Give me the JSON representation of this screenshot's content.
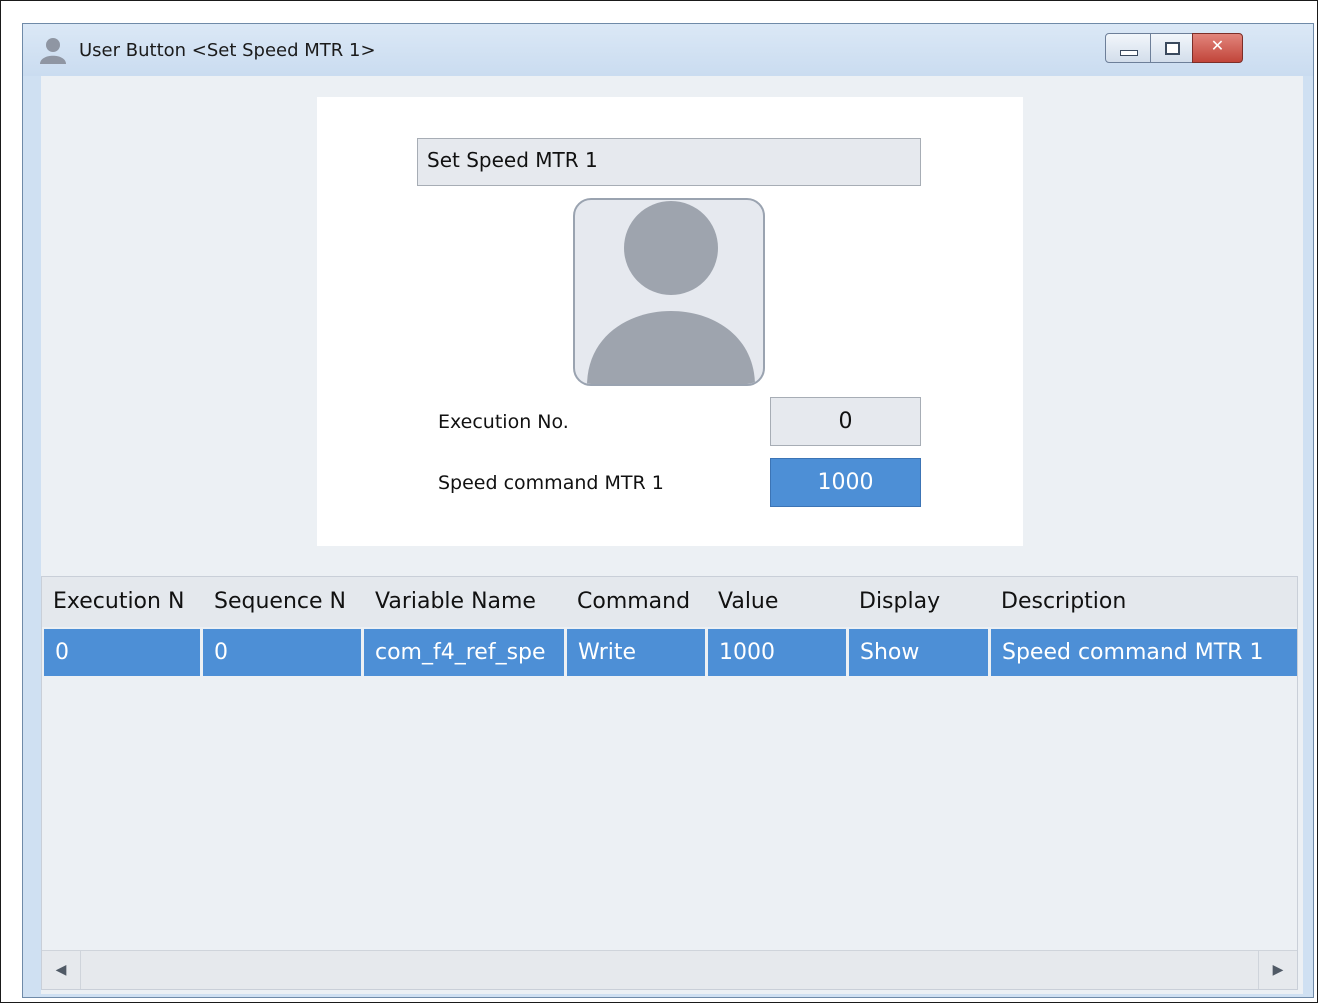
{
  "window": {
    "title": "User Button <Set Speed MTR 1>",
    "icon": "user-icon"
  },
  "preview": {
    "button_caption": "Set Speed MTR 1",
    "image": "user-avatar-icon",
    "fields": [
      {
        "label": "Execution No.",
        "value": "0"
      },
      {
        "label": "Speed command MTR 1",
        "value": "1000"
      }
    ]
  },
  "table": {
    "columns": [
      "Execution N",
      "Sequence N",
      "Variable Name",
      "Command",
      "Value",
      "Display",
      "Description"
    ],
    "rows": [
      [
        "0",
        "0",
        "com_f4_ref_spe",
        "Write",
        "1000",
        "Show",
        "Speed command MTR 1"
      ]
    ]
  },
  "colors": {
    "selection": "#4d8fd6",
    "window_frame": "#cfe0f2",
    "close_button": "#c1453a"
  }
}
